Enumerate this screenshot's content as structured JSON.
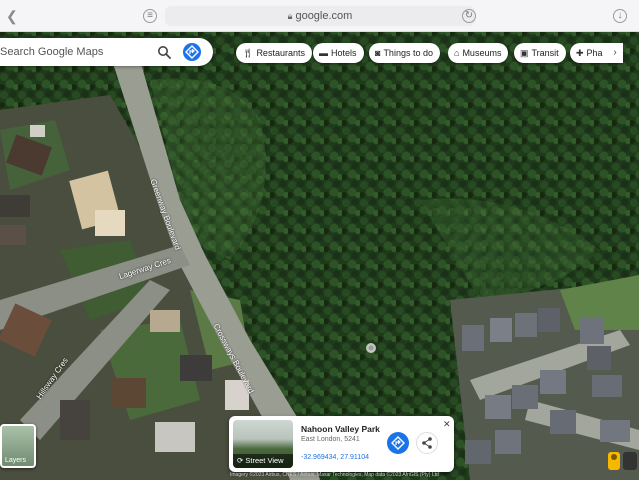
{
  "browser": {
    "url": "google.com",
    "colors": {
      "bar": "#f5f5f7",
      "url_field": "#ececef"
    }
  },
  "search": {
    "placeholder": "Search Google Maps",
    "value": ""
  },
  "categories": [
    {
      "icon": "restaurant-icon",
      "label": "Restaurants"
    },
    {
      "icon": "hotel-icon",
      "label": "Hotels"
    },
    {
      "icon": "camera-icon",
      "label": "Things to do"
    },
    {
      "icon": "museum-icon",
      "label": "Museums"
    },
    {
      "icon": "transit-icon",
      "label": "Transit"
    },
    {
      "icon": "pharmacy-icon",
      "label": "Pha"
    }
  ],
  "map": {
    "street_labels": [
      "Lagerway Cres",
      "Hillsway Cres",
      "Crossways Boulevard",
      "Greenway Boulevard"
    ]
  },
  "layers": {
    "label": "Layers"
  },
  "place": {
    "name": "Nahoon Valley Park",
    "subtitle": "East London, 5241",
    "coordinates": "-32.969434, 27.91104",
    "street_view_label": "Street View"
  },
  "attribution": "Imagery ©2023 Airbus, CNES / Airbus, Maxar Technologies, Map data ©2023 AfriGIS (Pty) Ltd",
  "colors": {
    "accent": "#1a73e8",
    "forest": "#1f3b1c",
    "road": "#9a9d92",
    "pegman": "#f6b900"
  }
}
